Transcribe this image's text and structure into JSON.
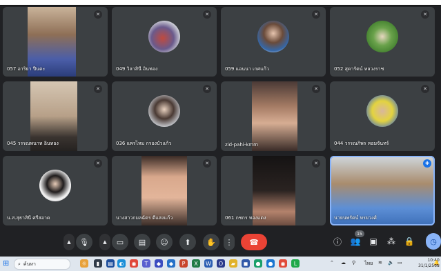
{
  "participants": [
    {
      "name": "057 อาริยา ปีนตะ"
    },
    {
      "name": "049 วิลาสินี อินทอง"
    },
    {
      "name": "059 แอนนา เกศแก้ว"
    },
    {
      "name": "052 สุดารัตน์ หลวงราช"
    },
    {
      "name": "045 วรรณพนาท อินทอง"
    },
    {
      "name": "036 แพรไหม กรองบัวแก้ว"
    },
    {
      "name": "zid-pahi-kmm"
    },
    {
      "name": "044 วรรณภิพร หอมจันทร์"
    },
    {
      "name": "น.ส.สุธาสินี ศรีสอาด"
    },
    {
      "name": "นางสาวกมลฉัตร ดีแสงแก้ว"
    },
    {
      "name": "061 กชกร ทองแดง"
    },
    {
      "name": "นายนพรัตน์ หรยวงศ์"
    }
  ],
  "controls": {
    "participant_count": "15"
  },
  "taskbar": {
    "search_placeholder": "ค้นหา",
    "time": "10:40",
    "date": "31/1/2568",
    "tray_lang": "ไทย"
  }
}
